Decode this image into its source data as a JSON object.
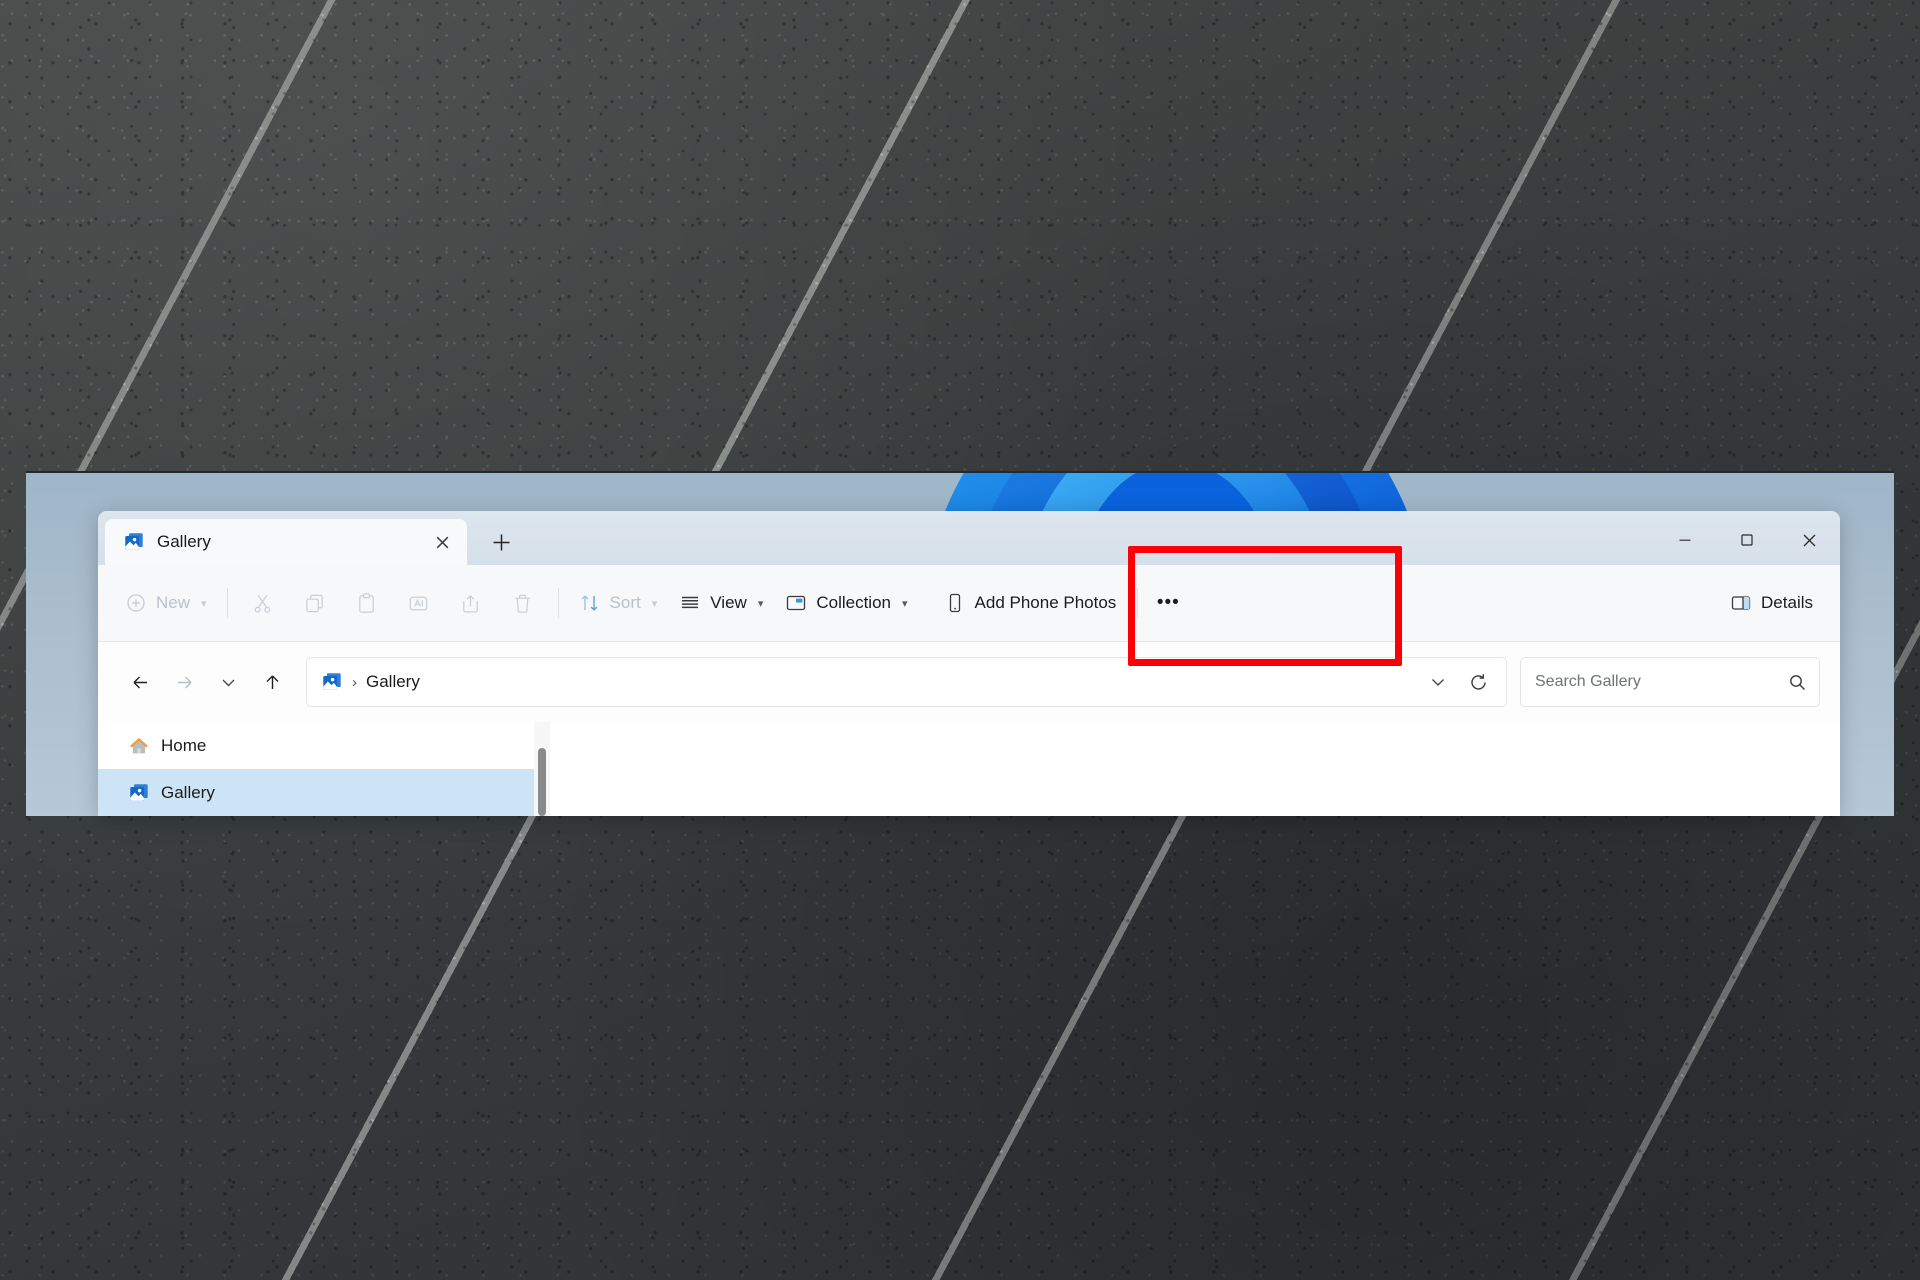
{
  "window": {
    "title": "Gallery",
    "tab": {
      "label": "Gallery",
      "icon": "gallery-icon",
      "close_icon": "close-icon"
    },
    "new_tab_label": "+",
    "controls": {
      "minimize": "–",
      "maximize": "□",
      "close": "✕"
    }
  },
  "toolbar": {
    "new_label": "New",
    "cut_label": "Cut",
    "copy_label": "Copy",
    "paste_label": "Paste",
    "rename_label": "Rename",
    "share_label": "Share",
    "delete_label": "Delete",
    "sort_label": "Sort",
    "view_label": "View",
    "collection_label": "Collection",
    "add_phone_photos_label": "Add Phone Photos",
    "overflow_label": "•••",
    "details_label": "Details"
  },
  "address": {
    "back_label": "Back",
    "forward_label": "Forward",
    "recent_label": "Recent locations",
    "up_label": "Up",
    "breadcrumb_separator": "›",
    "breadcrumb": "Gallery",
    "dropdown_label": "Previous locations",
    "refresh_label": "Refresh"
  },
  "search": {
    "placeholder": "Search Gallery",
    "value": "",
    "icon": "search-icon"
  },
  "sidebar": {
    "items": [
      {
        "label": "Home",
        "icon": "home-icon",
        "selected": false
      },
      {
        "label": "Gallery",
        "icon": "gallery-icon",
        "selected": true
      }
    ]
  },
  "annotation": {
    "target": "Add Phone Photos",
    "color": "#fb0007"
  },
  "colors": {
    "accent": "#0a72d1",
    "titlebar": "#d6e0ea",
    "backdrop": "#a9bdcd",
    "selection": "#cde4f7",
    "highlight": "#fb0007"
  }
}
